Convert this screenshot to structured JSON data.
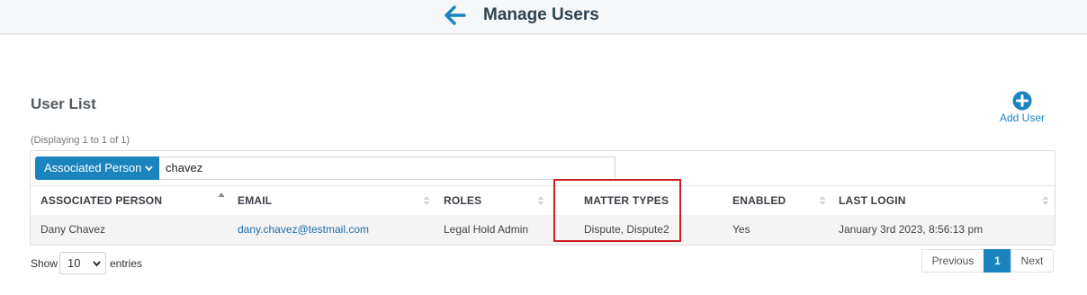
{
  "header": {
    "title": "Manage Users",
    "back_icon": "arrow-left-icon",
    "accent": "#1b84bf"
  },
  "user_list": {
    "title": "User List",
    "displaying": "(Displaying 1 to 1 of 1)",
    "add_user_label": "Add User",
    "add_icon": "plus-circle-icon"
  },
  "filter": {
    "field": "Associated Person",
    "value": "chavez"
  },
  "table": {
    "columns": [
      "ASSOCIATED PERSON",
      "EMAIL",
      "ROLES",
      "MATTER TYPES",
      "ENABLED",
      "LAST LOGIN"
    ],
    "rows": [
      {
        "associated_person": "Dany Chavez",
        "email": "dany.chavez@testmail.com",
        "roles": "Legal Hold Admin",
        "matter_types": "Dispute, Dispute2",
        "enabled": "Yes",
        "last_login": "January 3rd 2023, 8:56:13 pm"
      }
    ]
  },
  "footer": {
    "show_label": "Show",
    "entries_value": "10",
    "entries_label": "entries",
    "pagination": {
      "previous": "Previous",
      "current_page": "1",
      "next": "Next"
    }
  },
  "highlight_color": "#cc2027"
}
